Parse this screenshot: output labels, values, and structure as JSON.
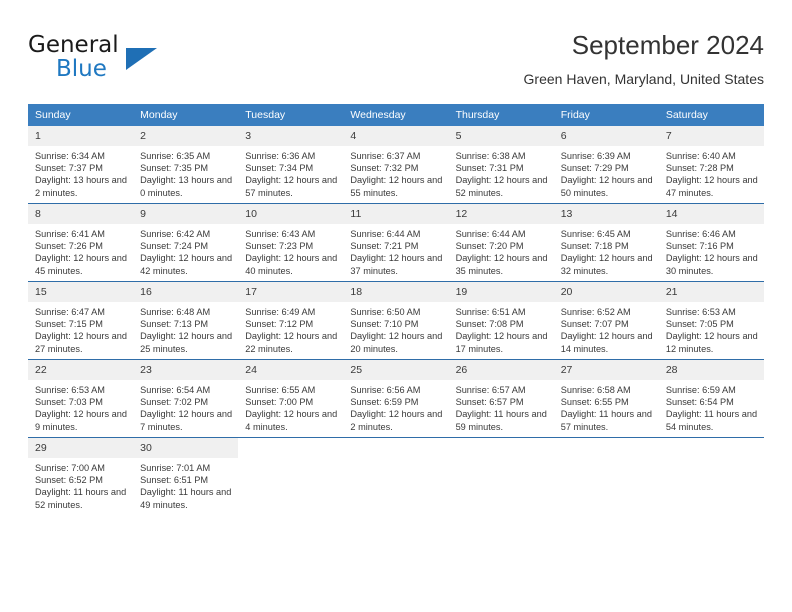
{
  "logo": {
    "word1": "General",
    "word2": "Blue",
    "accent_color": "#1f6fb5"
  },
  "header": {
    "title": "September 2024",
    "location": "Green Haven, Maryland, United States"
  },
  "theme": {
    "header_bg": "#3a7ebf",
    "row_divider": "#2f6da8",
    "daynum_bg": "#f0f0f0"
  },
  "weekday_headers": [
    "Sunday",
    "Monday",
    "Tuesday",
    "Wednesday",
    "Thursday",
    "Friday",
    "Saturday"
  ],
  "weeks": [
    [
      {
        "day": "1",
        "sunrise": "Sunrise: 6:34 AM",
        "sunset": "Sunset: 7:37 PM",
        "daylight": "Daylight: 13 hours and 2 minutes."
      },
      {
        "day": "2",
        "sunrise": "Sunrise: 6:35 AM",
        "sunset": "Sunset: 7:35 PM",
        "daylight": "Daylight: 13 hours and 0 minutes."
      },
      {
        "day": "3",
        "sunrise": "Sunrise: 6:36 AM",
        "sunset": "Sunset: 7:34 PM",
        "daylight": "Daylight: 12 hours and 57 minutes."
      },
      {
        "day": "4",
        "sunrise": "Sunrise: 6:37 AM",
        "sunset": "Sunset: 7:32 PM",
        "daylight": "Daylight: 12 hours and 55 minutes."
      },
      {
        "day": "5",
        "sunrise": "Sunrise: 6:38 AM",
        "sunset": "Sunset: 7:31 PM",
        "daylight": "Daylight: 12 hours and 52 minutes."
      },
      {
        "day": "6",
        "sunrise": "Sunrise: 6:39 AM",
        "sunset": "Sunset: 7:29 PM",
        "daylight": "Daylight: 12 hours and 50 minutes."
      },
      {
        "day": "7",
        "sunrise": "Sunrise: 6:40 AM",
        "sunset": "Sunset: 7:28 PM",
        "daylight": "Daylight: 12 hours and 47 minutes."
      }
    ],
    [
      {
        "day": "8",
        "sunrise": "Sunrise: 6:41 AM",
        "sunset": "Sunset: 7:26 PM",
        "daylight": "Daylight: 12 hours and 45 minutes."
      },
      {
        "day": "9",
        "sunrise": "Sunrise: 6:42 AM",
        "sunset": "Sunset: 7:24 PM",
        "daylight": "Daylight: 12 hours and 42 minutes."
      },
      {
        "day": "10",
        "sunrise": "Sunrise: 6:43 AM",
        "sunset": "Sunset: 7:23 PM",
        "daylight": "Daylight: 12 hours and 40 minutes."
      },
      {
        "day": "11",
        "sunrise": "Sunrise: 6:44 AM",
        "sunset": "Sunset: 7:21 PM",
        "daylight": "Daylight: 12 hours and 37 minutes."
      },
      {
        "day": "12",
        "sunrise": "Sunrise: 6:44 AM",
        "sunset": "Sunset: 7:20 PM",
        "daylight": "Daylight: 12 hours and 35 minutes."
      },
      {
        "day": "13",
        "sunrise": "Sunrise: 6:45 AM",
        "sunset": "Sunset: 7:18 PM",
        "daylight": "Daylight: 12 hours and 32 minutes."
      },
      {
        "day": "14",
        "sunrise": "Sunrise: 6:46 AM",
        "sunset": "Sunset: 7:16 PM",
        "daylight": "Daylight: 12 hours and 30 minutes."
      }
    ],
    [
      {
        "day": "15",
        "sunrise": "Sunrise: 6:47 AM",
        "sunset": "Sunset: 7:15 PM",
        "daylight": "Daylight: 12 hours and 27 minutes."
      },
      {
        "day": "16",
        "sunrise": "Sunrise: 6:48 AM",
        "sunset": "Sunset: 7:13 PM",
        "daylight": "Daylight: 12 hours and 25 minutes."
      },
      {
        "day": "17",
        "sunrise": "Sunrise: 6:49 AM",
        "sunset": "Sunset: 7:12 PM",
        "daylight": "Daylight: 12 hours and 22 minutes."
      },
      {
        "day": "18",
        "sunrise": "Sunrise: 6:50 AM",
        "sunset": "Sunset: 7:10 PM",
        "daylight": "Daylight: 12 hours and 20 minutes."
      },
      {
        "day": "19",
        "sunrise": "Sunrise: 6:51 AM",
        "sunset": "Sunset: 7:08 PM",
        "daylight": "Daylight: 12 hours and 17 minutes."
      },
      {
        "day": "20",
        "sunrise": "Sunrise: 6:52 AM",
        "sunset": "Sunset: 7:07 PM",
        "daylight": "Daylight: 12 hours and 14 minutes."
      },
      {
        "day": "21",
        "sunrise": "Sunrise: 6:53 AM",
        "sunset": "Sunset: 7:05 PM",
        "daylight": "Daylight: 12 hours and 12 minutes."
      }
    ],
    [
      {
        "day": "22",
        "sunrise": "Sunrise: 6:53 AM",
        "sunset": "Sunset: 7:03 PM",
        "daylight": "Daylight: 12 hours and 9 minutes."
      },
      {
        "day": "23",
        "sunrise": "Sunrise: 6:54 AM",
        "sunset": "Sunset: 7:02 PM",
        "daylight": "Daylight: 12 hours and 7 minutes."
      },
      {
        "day": "24",
        "sunrise": "Sunrise: 6:55 AM",
        "sunset": "Sunset: 7:00 PM",
        "daylight": "Daylight: 12 hours and 4 minutes."
      },
      {
        "day": "25",
        "sunrise": "Sunrise: 6:56 AM",
        "sunset": "Sunset: 6:59 PM",
        "daylight": "Daylight: 12 hours and 2 minutes."
      },
      {
        "day": "26",
        "sunrise": "Sunrise: 6:57 AM",
        "sunset": "Sunset: 6:57 PM",
        "daylight": "Daylight: 11 hours and 59 minutes."
      },
      {
        "day": "27",
        "sunrise": "Sunrise: 6:58 AM",
        "sunset": "Sunset: 6:55 PM",
        "daylight": "Daylight: 11 hours and 57 minutes."
      },
      {
        "day": "28",
        "sunrise": "Sunrise: 6:59 AM",
        "sunset": "Sunset: 6:54 PM",
        "daylight": "Daylight: 11 hours and 54 minutes."
      }
    ],
    [
      {
        "day": "29",
        "sunrise": "Sunrise: 7:00 AM",
        "sunset": "Sunset: 6:52 PM",
        "daylight": "Daylight: 11 hours and 52 minutes."
      },
      {
        "day": "30",
        "sunrise": "Sunrise: 7:01 AM",
        "sunset": "Sunset: 6:51 PM",
        "daylight": "Daylight: 11 hours and 49 minutes."
      },
      {
        "day": "",
        "sunrise": "",
        "sunset": "",
        "daylight": ""
      },
      {
        "day": "",
        "sunrise": "",
        "sunset": "",
        "daylight": ""
      },
      {
        "day": "",
        "sunrise": "",
        "sunset": "",
        "daylight": ""
      },
      {
        "day": "",
        "sunrise": "",
        "sunset": "",
        "daylight": ""
      },
      {
        "day": "",
        "sunrise": "",
        "sunset": "",
        "daylight": ""
      }
    ]
  ]
}
